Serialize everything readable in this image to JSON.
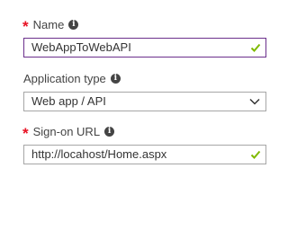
{
  "name_field": {
    "label": "Name",
    "required_marker": "*",
    "value": "WebAppToWebAPI"
  },
  "app_type_field": {
    "label": "Application type",
    "selected": "Web app / API"
  },
  "signon_field": {
    "label": "Sign-on URL",
    "required_marker": "*",
    "value": "http://locahost/Home.aspx"
  },
  "icons": {
    "info": "info-icon",
    "valid": "checkmark-icon",
    "dropdown": "chevron-down-icon"
  },
  "colors": {
    "required": "#e81123",
    "valid_check": "#7fba00",
    "focus_border": "#6b2f8c"
  }
}
